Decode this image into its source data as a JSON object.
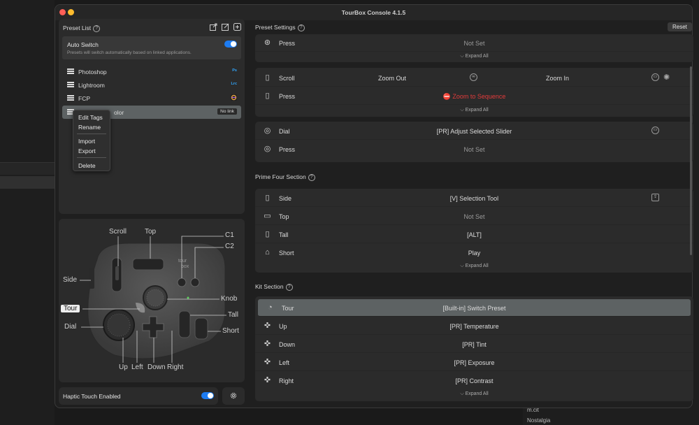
{
  "window": {
    "title": "TourBox Console 4.1.5"
  },
  "preset_list": {
    "header": "Preset List",
    "hint": "?",
    "auto_switch": {
      "title": "Auto Switch",
      "desc": "Presets will switch automatically based on linked applications."
    },
    "items": [
      {
        "label": "Photoshop",
        "badge": "Ps"
      },
      {
        "label": "Lightroom",
        "badge": "Lrc"
      },
      {
        "label": "FCP",
        "badge": ""
      },
      {
        "label": "olor",
        "link": "No link"
      }
    ]
  },
  "context_menu": [
    "Edit Tags",
    "Rename",
    "Import",
    "Export",
    "Delete"
  ],
  "device_labels": {
    "scroll": "Scroll",
    "top": "Top",
    "c1": "C1",
    "c2": "C2",
    "side": "Side",
    "knob": "Knob",
    "tour": "Tour",
    "tall": "Tall",
    "dial": "Dial",
    "short": "Short",
    "up": "Up",
    "left": "Left",
    "down": "Down",
    "right": "Right"
  },
  "haptic": {
    "label": "Haptic Touch Enabled"
  },
  "preset_settings": {
    "header": "Preset Settings",
    "reset": "Reset",
    "expand_all": "Expand All",
    "group0": [
      {
        "label": "Press",
        "value": "Not Set"
      }
    ],
    "group1": [
      {
        "label": "Scroll",
        "left": "Zoom Out",
        "right": "Zoom In"
      },
      {
        "label": "Press",
        "value": "⛔ Zoom to Sequence"
      }
    ],
    "group2": [
      {
        "label": "Dial",
        "value": "[PR] Adjust Selected Slider"
      },
      {
        "label": "Press",
        "value": "Not Set"
      }
    ]
  },
  "prime_four": {
    "header": "Prime Four Section",
    "rows": [
      {
        "label": "Side",
        "value": "[V] Selection Tool"
      },
      {
        "label": "Top",
        "value": "Not Set"
      },
      {
        "label": "Tall",
        "value": "[ALT]"
      },
      {
        "label": "Short",
        "value": "Play"
      }
    ]
  },
  "kit": {
    "header": "Kit Section",
    "rows": [
      {
        "label": "Tour",
        "value": "[Built-in] Switch Preset"
      },
      {
        "label": "Up",
        "value": "[PR] Temperature"
      },
      {
        "label": "Down",
        "value": "[PR] Tint"
      },
      {
        "label": "Left",
        "value": "[PR] Exposure"
      },
      {
        "label": "Right",
        "value": "[PR] Contrast"
      }
    ]
  },
  "desktop": {
    "item1": "m.cit",
    "item2": "Nostalgia"
  },
  "colors": {
    "accent": "#1d7cf2",
    "danger": "#e23b3b",
    "selected_row": "#5d6263"
  }
}
